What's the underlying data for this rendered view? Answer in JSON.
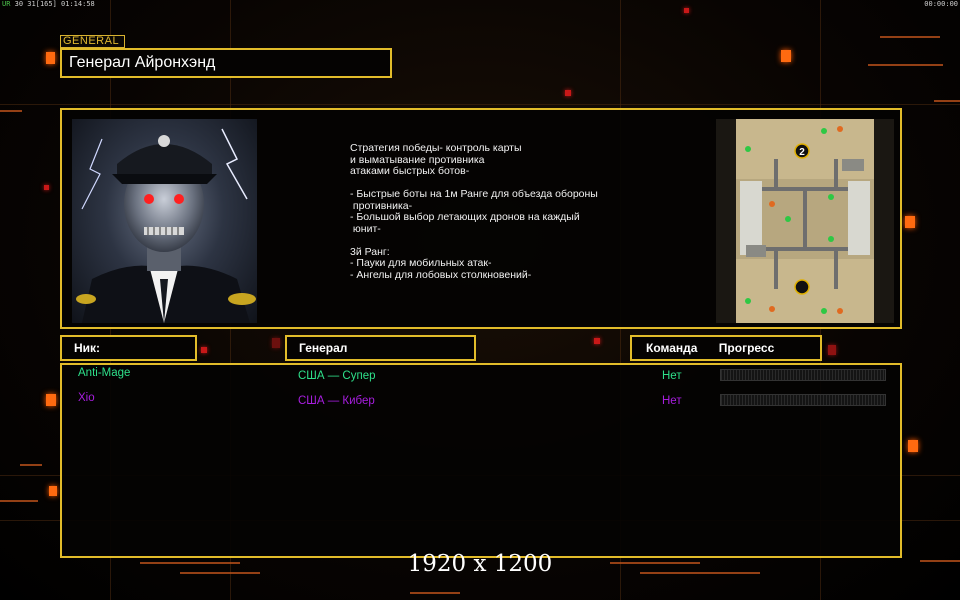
{
  "status": {
    "left_fps": "UR",
    "left_text": "30 31",
    "left_bracket": "[165]",
    "left_time": "01:14:58",
    "right_time": "00:00:00"
  },
  "general": {
    "tag": "GENERAL",
    "name": "Генерал Айронхэнд",
    "description": "Стратегия победы- контроль карты\nи выматывание противника\nатаками быстрых ботов-\n\n- Быстрые боты на 1м Ранге для объезда обороны\n противника-\n- Большой выбор летающих дронов на каждый\n юнит-\n\n3й Ранг:\n- Пауки для мобильных атак-\n- Ангелы для лобовых столкновений-"
  },
  "minimap": {
    "marker_label": "2"
  },
  "table": {
    "nick_header": "Ник:",
    "general_header": "Генерал",
    "team_header": "Команда",
    "progress_header": "Прогресс",
    "players": [
      {
        "nick": "Anti-Mage",
        "general": "США — Супер",
        "team": "Нет",
        "color": "#2ee08a",
        "progress": 0
      },
      {
        "nick": "Xio",
        "general": "США — Кибер",
        "team": "Нет",
        "color": "#a81ee0",
        "progress": 0
      }
    ]
  },
  "resolution_label": "1920 x 1200",
  "colors": {
    "accent": "#e2bc2a",
    "highlight": "#ff6a10"
  }
}
